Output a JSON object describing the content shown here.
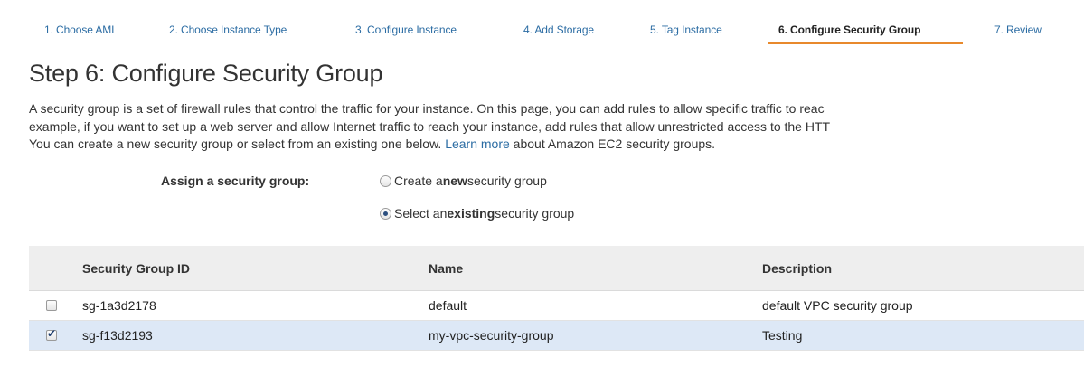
{
  "wizard": {
    "steps": [
      {
        "label": "1. Choose AMI"
      },
      {
        "label": "2. Choose Instance Type"
      },
      {
        "label": "3. Configure Instance"
      },
      {
        "label": "4. Add Storage"
      },
      {
        "label": "5. Tag Instance"
      },
      {
        "label": "6. Configure Security Group"
      },
      {
        "label": "7. Review"
      }
    ],
    "active_step_index": 5,
    "active_color": "#e8892c",
    "link_color": "#2b6ca3"
  },
  "page": {
    "title": "Step 6: Configure Security Group",
    "description_lines": [
      "A security group is a set of firewall rules that control the traffic for your instance. On this page, you can add rules to allow specific traffic to reac",
      "example, if you want to set up a web server and allow Internet traffic to reach your instance, add rules that allow unrestricted access to the HTT"
    ],
    "description_line3_before": "You can create a new security group or select from an existing one below. ",
    "learn_more_link": "Learn more",
    "description_line3_after": " about Amazon EC2 security groups."
  },
  "assign": {
    "label": "Assign a security group:",
    "options": [
      {
        "prefix": "Create a ",
        "bold": "new",
        "suffix": " security group",
        "checked": false
      },
      {
        "prefix": "Select an ",
        "bold": "existing",
        "suffix": " security group",
        "checked": true
      }
    ]
  },
  "table": {
    "columns": [
      "Security Group ID",
      "Name",
      "Description"
    ],
    "rows": [
      {
        "checked": false,
        "id": "sg-1a3d2178",
        "name": "default",
        "description": "default VPC security group"
      },
      {
        "checked": true,
        "id": "sg-f13d2193",
        "name": "my-vpc-security-group",
        "description": "Testing"
      }
    ],
    "selected_row_color": "#dde8f6"
  }
}
